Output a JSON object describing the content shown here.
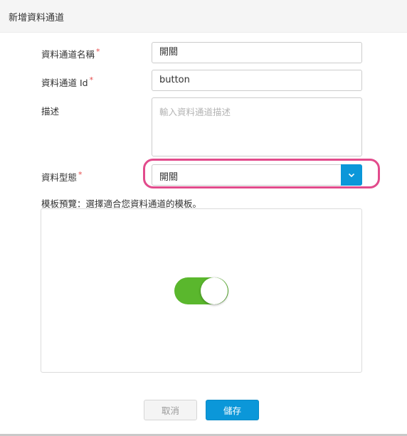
{
  "header": {
    "title": "新增資料通道"
  },
  "form": {
    "name_label": "資料通道名稱",
    "name_value": "開關",
    "id_label": "資料通道 Id",
    "id_value": "button",
    "desc_label": "描述",
    "desc_placeholder": "輸入資料通道描述",
    "type_label": "資料型態",
    "type_value": "開關",
    "required_mark": "*"
  },
  "preview": {
    "label": "模板預覽：選擇適合您資料通道的模板。",
    "toggle_on": true
  },
  "actions": {
    "cancel_label": "取消",
    "save_label": "儲存"
  },
  "colors": {
    "accent": "#0b97d9",
    "required": "#e54b4b",
    "toggle_on": "#5ab72d",
    "highlight": "#e24b8c"
  }
}
